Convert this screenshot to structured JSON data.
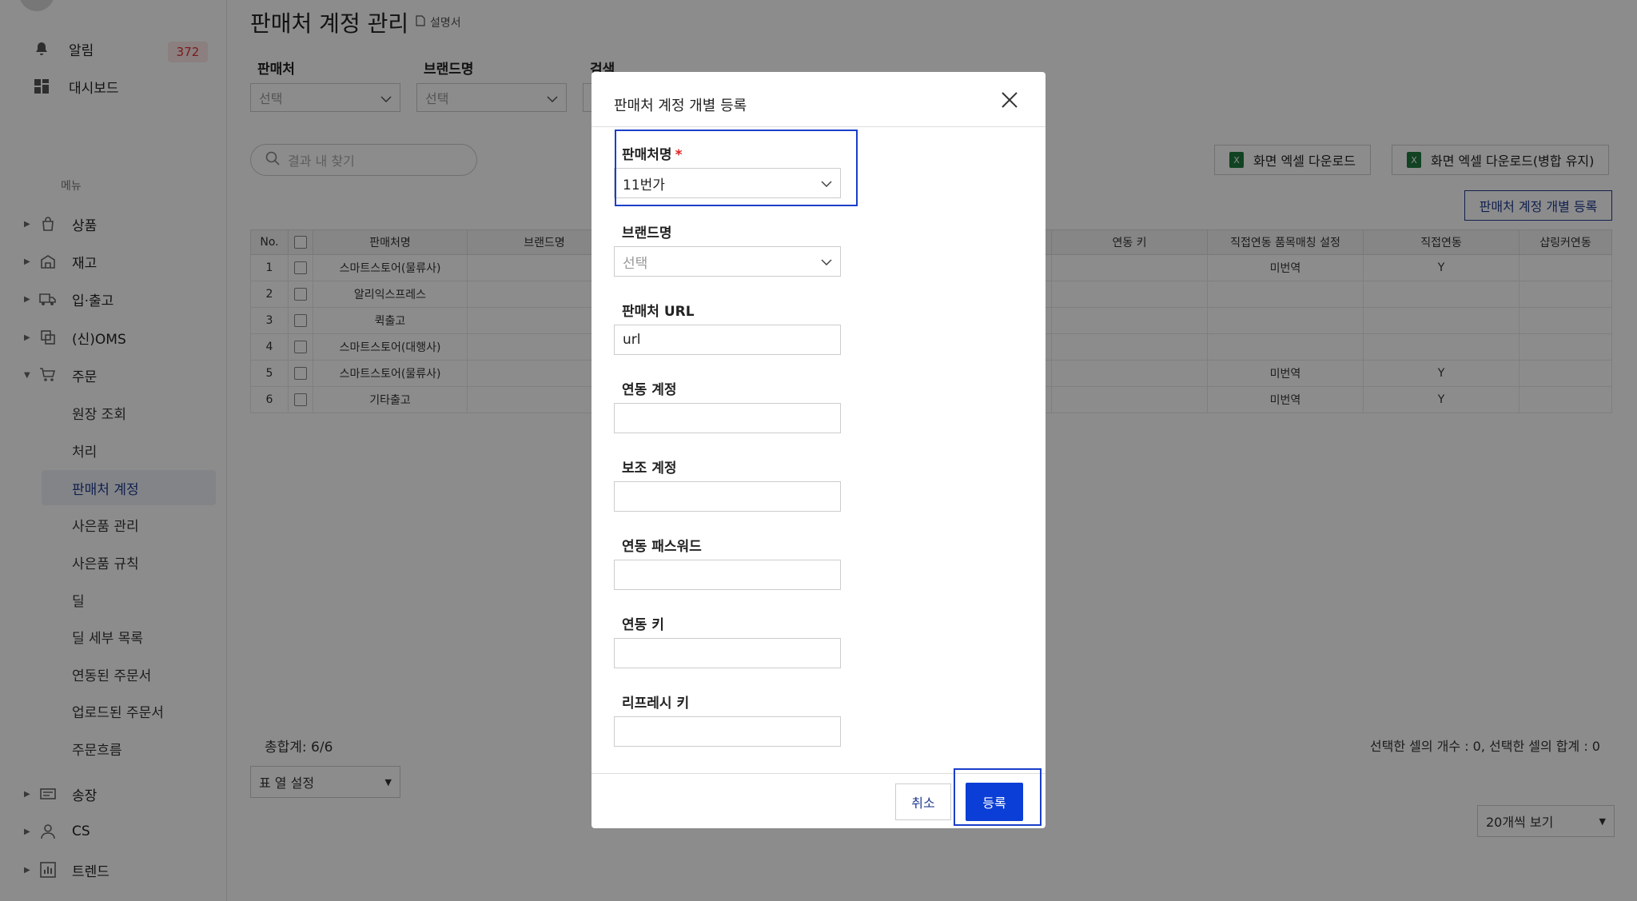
{
  "sidebar": {
    "alerts_label": "알림",
    "alerts_count": "372",
    "dashboard_label": "대시보드",
    "menu_heading": "메뉴",
    "nav": [
      {
        "label": "상품"
      },
      {
        "label": "재고"
      },
      {
        "label": "입·출고"
      },
      {
        "label": "(신)OMS"
      },
      {
        "label": "주문"
      }
    ],
    "order_sub": [
      {
        "label": "원장 조회"
      },
      {
        "label": "처리"
      },
      {
        "label": "판매처 계정"
      },
      {
        "label": "사은품 관리"
      },
      {
        "label": "사은품 규칙"
      },
      {
        "label": "딜"
      },
      {
        "label": "딜 세부 목록"
      },
      {
        "label": "연동된 주문서"
      },
      {
        "label": "업로드된 주문서"
      },
      {
        "label": "주문흐름"
      }
    ],
    "nav_bottom": [
      {
        "label": "송장"
      },
      {
        "label": "CS"
      },
      {
        "label": "트렌드"
      }
    ]
  },
  "page": {
    "title": "판매처 계정 관리",
    "manual_label": "설명서",
    "filters": {
      "seller_label": "판매처",
      "seller_value": "선택",
      "brand_label": "브랜드명",
      "brand_value": "선택",
      "search_label": "검색"
    },
    "search_placeholder": "결과 내 찾기",
    "excel_download": "화면 엑셀 다운로드",
    "excel_download_merge": "화면 엑셀 다운로드(병합 유지)",
    "register_button": "판매처 계정 개별 등록",
    "table": {
      "headers": {
        "no": "No.",
        "seller": "판매처명",
        "brand": "브랜드명",
        "link_key": "연동 키",
        "direct_match": "직접연동 품목매칭 설정",
        "direct": "직접연동",
        "shopping": "샵링커연동"
      },
      "rows": [
        {
          "no": "1",
          "seller": "스마트스토어(물류사)",
          "direct_match": "미번역",
          "direct": "Y"
        },
        {
          "no": "2",
          "seller": "알리익스프레스",
          "direct_match": "",
          "direct": ""
        },
        {
          "no": "3",
          "seller": "퀵출고",
          "direct_match": "",
          "direct": ""
        },
        {
          "no": "4",
          "seller": "스마트스토어(대행사)",
          "direct_match": "",
          "direct": ""
        },
        {
          "no": "5",
          "seller": "스마트스토어(물류사)",
          "direct_match": "미번역",
          "direct": "Y"
        },
        {
          "no": "6",
          "seller": "기타출고",
          "direct_match": "미번역",
          "direct": "Y"
        }
      ]
    },
    "total": "총합계: 6/6",
    "selection_summary": "선택한 셀의 개수 : 0, 선택한 셀의 합계 : 0",
    "column_settings": "표 열 설정",
    "page_size": "20개씩 보기"
  },
  "modal": {
    "title": "판매처 계정 개별 등록",
    "fields": {
      "seller_name_label": "판매처명",
      "seller_name_required": "*",
      "seller_name_value": "11번가",
      "brand_label": "브랜드명",
      "brand_value": "선택",
      "url_label": "판매처 URL",
      "url_value": "url",
      "account_label": "연동 계정",
      "account_value": "",
      "sub_account_label": "보조 계정",
      "sub_account_value": "",
      "password_label": "연동 패스워드",
      "password_value": "",
      "key_label": "연동 키",
      "key_value": "",
      "refresh_label": "리프레시 키",
      "refresh_value": ""
    },
    "cancel_label": "취소",
    "submit_label": "등록"
  },
  "colors": {
    "accent": "#0b3ed6",
    "highlight": "#1a3fc8",
    "badge_text": "#dd3333",
    "required": "#e02020"
  }
}
